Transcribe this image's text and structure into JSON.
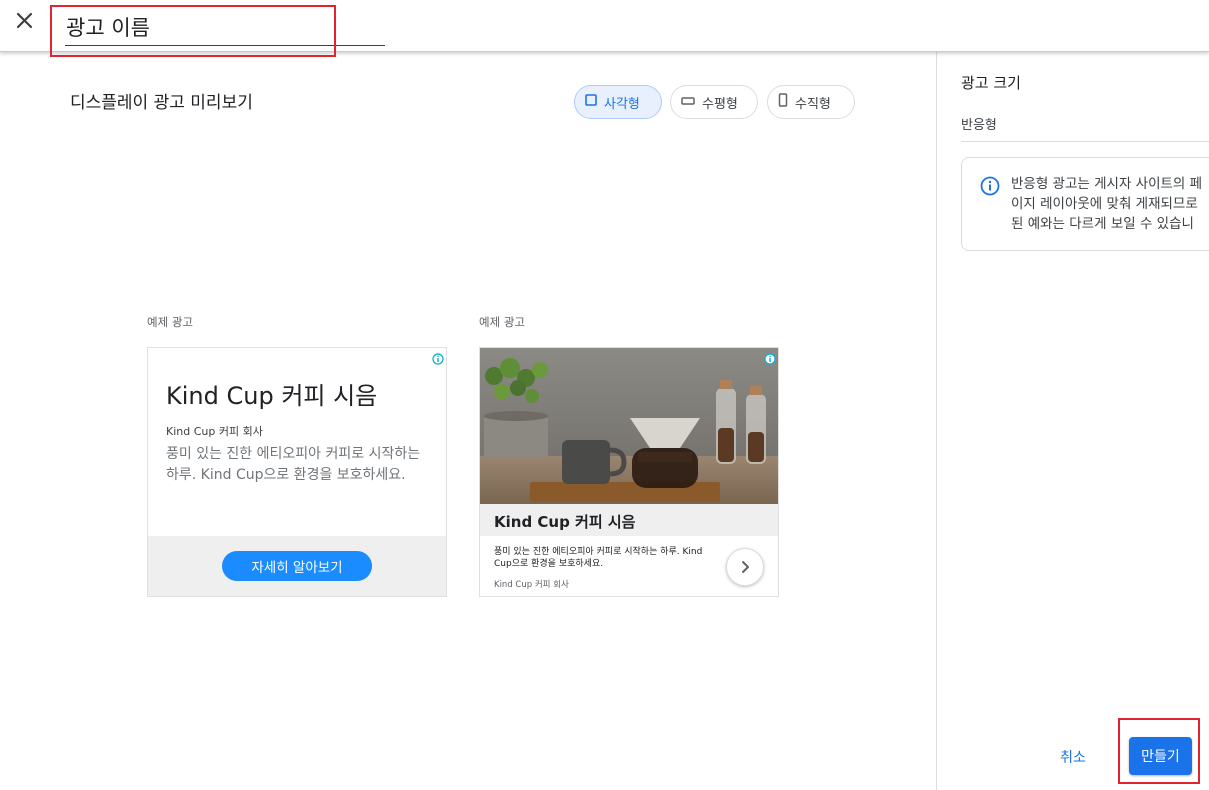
{
  "header": {
    "ad_name_value": "광고 이름"
  },
  "preview": {
    "title": "디스플레이 광고 미리보기",
    "formats": [
      {
        "label": "사각형",
        "selected": true
      },
      {
        "label": "수평형",
        "selected": false
      },
      {
        "label": "수직형",
        "selected": false
      }
    ],
    "sample_ads": [
      {
        "label": "예제 광고",
        "headline": "Kind Cup 커피 시음",
        "business": "Kind Cup 커피 회사",
        "description": "풍미 있는 진한 에티오피아 커피로 시작하는 하루. Kind Cup으로 환경을 보호하세요.",
        "cta": "자세히 알아보기"
      },
      {
        "label": "예제 광고",
        "headline": "Kind Cup 커피 시음",
        "description": "풍미 있는 진한 에티오피아 커피로 시작하는 하루. Kind Cup으로 환경을 보호하세요.",
        "business": "Kind Cup 커피 회사"
      }
    ]
  },
  "side_panel": {
    "title": "광고 크기",
    "size_value": "반응형",
    "info_lines": [
      "반응형 광고는 게시자 사이트의 페",
      "이지 레이아웃에 맞춰 게재되므로",
      "된 예와는 다르게 보일 수 있습니"
    ]
  },
  "actions": {
    "cancel": "취소",
    "create": "만들기"
  },
  "colors": {
    "accent": "#1a73e8",
    "highlight": "#e0232e",
    "cta": "#1a8cff"
  }
}
